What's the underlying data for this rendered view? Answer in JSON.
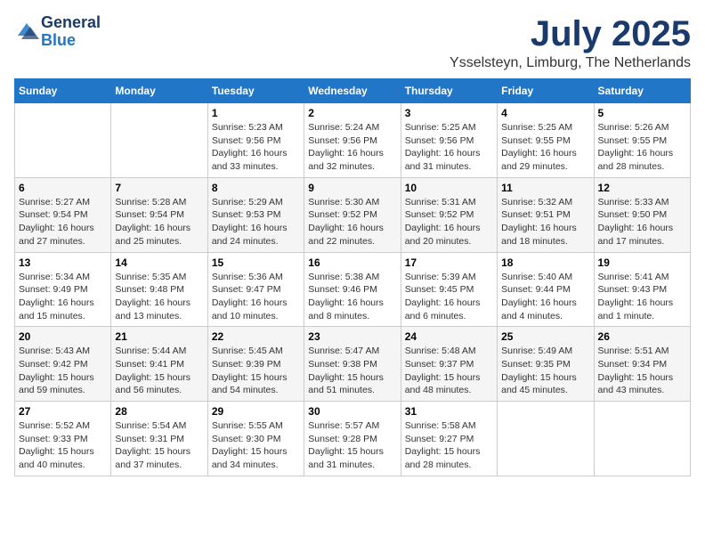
{
  "header": {
    "logo_line1": "General",
    "logo_line2": "Blue",
    "month": "July 2025",
    "location": "Ysselsteyn, Limburg, The Netherlands"
  },
  "weekdays": [
    "Sunday",
    "Monday",
    "Tuesday",
    "Wednesday",
    "Thursday",
    "Friday",
    "Saturday"
  ],
  "weeks": [
    [
      {
        "day": "",
        "detail": ""
      },
      {
        "day": "",
        "detail": ""
      },
      {
        "day": "1",
        "detail": "Sunrise: 5:23 AM\nSunset: 9:56 PM\nDaylight: 16 hours\nand 33 minutes."
      },
      {
        "day": "2",
        "detail": "Sunrise: 5:24 AM\nSunset: 9:56 PM\nDaylight: 16 hours\nand 32 minutes."
      },
      {
        "day": "3",
        "detail": "Sunrise: 5:25 AM\nSunset: 9:56 PM\nDaylight: 16 hours\nand 31 minutes."
      },
      {
        "day": "4",
        "detail": "Sunrise: 5:25 AM\nSunset: 9:55 PM\nDaylight: 16 hours\nand 29 minutes."
      },
      {
        "day": "5",
        "detail": "Sunrise: 5:26 AM\nSunset: 9:55 PM\nDaylight: 16 hours\nand 28 minutes."
      }
    ],
    [
      {
        "day": "6",
        "detail": "Sunrise: 5:27 AM\nSunset: 9:54 PM\nDaylight: 16 hours\nand 27 minutes."
      },
      {
        "day": "7",
        "detail": "Sunrise: 5:28 AM\nSunset: 9:54 PM\nDaylight: 16 hours\nand 25 minutes."
      },
      {
        "day": "8",
        "detail": "Sunrise: 5:29 AM\nSunset: 9:53 PM\nDaylight: 16 hours\nand 24 minutes."
      },
      {
        "day": "9",
        "detail": "Sunrise: 5:30 AM\nSunset: 9:52 PM\nDaylight: 16 hours\nand 22 minutes."
      },
      {
        "day": "10",
        "detail": "Sunrise: 5:31 AM\nSunset: 9:52 PM\nDaylight: 16 hours\nand 20 minutes."
      },
      {
        "day": "11",
        "detail": "Sunrise: 5:32 AM\nSunset: 9:51 PM\nDaylight: 16 hours\nand 18 minutes."
      },
      {
        "day": "12",
        "detail": "Sunrise: 5:33 AM\nSunset: 9:50 PM\nDaylight: 16 hours\nand 17 minutes."
      }
    ],
    [
      {
        "day": "13",
        "detail": "Sunrise: 5:34 AM\nSunset: 9:49 PM\nDaylight: 16 hours\nand 15 minutes."
      },
      {
        "day": "14",
        "detail": "Sunrise: 5:35 AM\nSunset: 9:48 PM\nDaylight: 16 hours\nand 13 minutes."
      },
      {
        "day": "15",
        "detail": "Sunrise: 5:36 AM\nSunset: 9:47 PM\nDaylight: 16 hours\nand 10 minutes."
      },
      {
        "day": "16",
        "detail": "Sunrise: 5:38 AM\nSunset: 9:46 PM\nDaylight: 16 hours\nand 8 minutes."
      },
      {
        "day": "17",
        "detail": "Sunrise: 5:39 AM\nSunset: 9:45 PM\nDaylight: 16 hours\nand 6 minutes."
      },
      {
        "day": "18",
        "detail": "Sunrise: 5:40 AM\nSunset: 9:44 PM\nDaylight: 16 hours\nand 4 minutes."
      },
      {
        "day": "19",
        "detail": "Sunrise: 5:41 AM\nSunset: 9:43 PM\nDaylight: 16 hours\nand 1 minute."
      }
    ],
    [
      {
        "day": "20",
        "detail": "Sunrise: 5:43 AM\nSunset: 9:42 PM\nDaylight: 15 hours\nand 59 minutes."
      },
      {
        "day": "21",
        "detail": "Sunrise: 5:44 AM\nSunset: 9:41 PM\nDaylight: 15 hours\nand 56 minutes."
      },
      {
        "day": "22",
        "detail": "Sunrise: 5:45 AM\nSunset: 9:39 PM\nDaylight: 15 hours\nand 54 minutes."
      },
      {
        "day": "23",
        "detail": "Sunrise: 5:47 AM\nSunset: 9:38 PM\nDaylight: 15 hours\nand 51 minutes."
      },
      {
        "day": "24",
        "detail": "Sunrise: 5:48 AM\nSunset: 9:37 PM\nDaylight: 15 hours\nand 48 minutes."
      },
      {
        "day": "25",
        "detail": "Sunrise: 5:49 AM\nSunset: 9:35 PM\nDaylight: 15 hours\nand 45 minutes."
      },
      {
        "day": "26",
        "detail": "Sunrise: 5:51 AM\nSunset: 9:34 PM\nDaylight: 15 hours\nand 43 minutes."
      }
    ],
    [
      {
        "day": "27",
        "detail": "Sunrise: 5:52 AM\nSunset: 9:33 PM\nDaylight: 15 hours\nand 40 minutes."
      },
      {
        "day": "28",
        "detail": "Sunrise: 5:54 AM\nSunset: 9:31 PM\nDaylight: 15 hours\nand 37 minutes."
      },
      {
        "day": "29",
        "detail": "Sunrise: 5:55 AM\nSunset: 9:30 PM\nDaylight: 15 hours\nand 34 minutes."
      },
      {
        "day": "30",
        "detail": "Sunrise: 5:57 AM\nSunset: 9:28 PM\nDaylight: 15 hours\nand 31 minutes."
      },
      {
        "day": "31",
        "detail": "Sunrise: 5:58 AM\nSunset: 9:27 PM\nDaylight: 15 hours\nand 28 minutes."
      },
      {
        "day": "",
        "detail": ""
      },
      {
        "day": "",
        "detail": ""
      }
    ]
  ]
}
